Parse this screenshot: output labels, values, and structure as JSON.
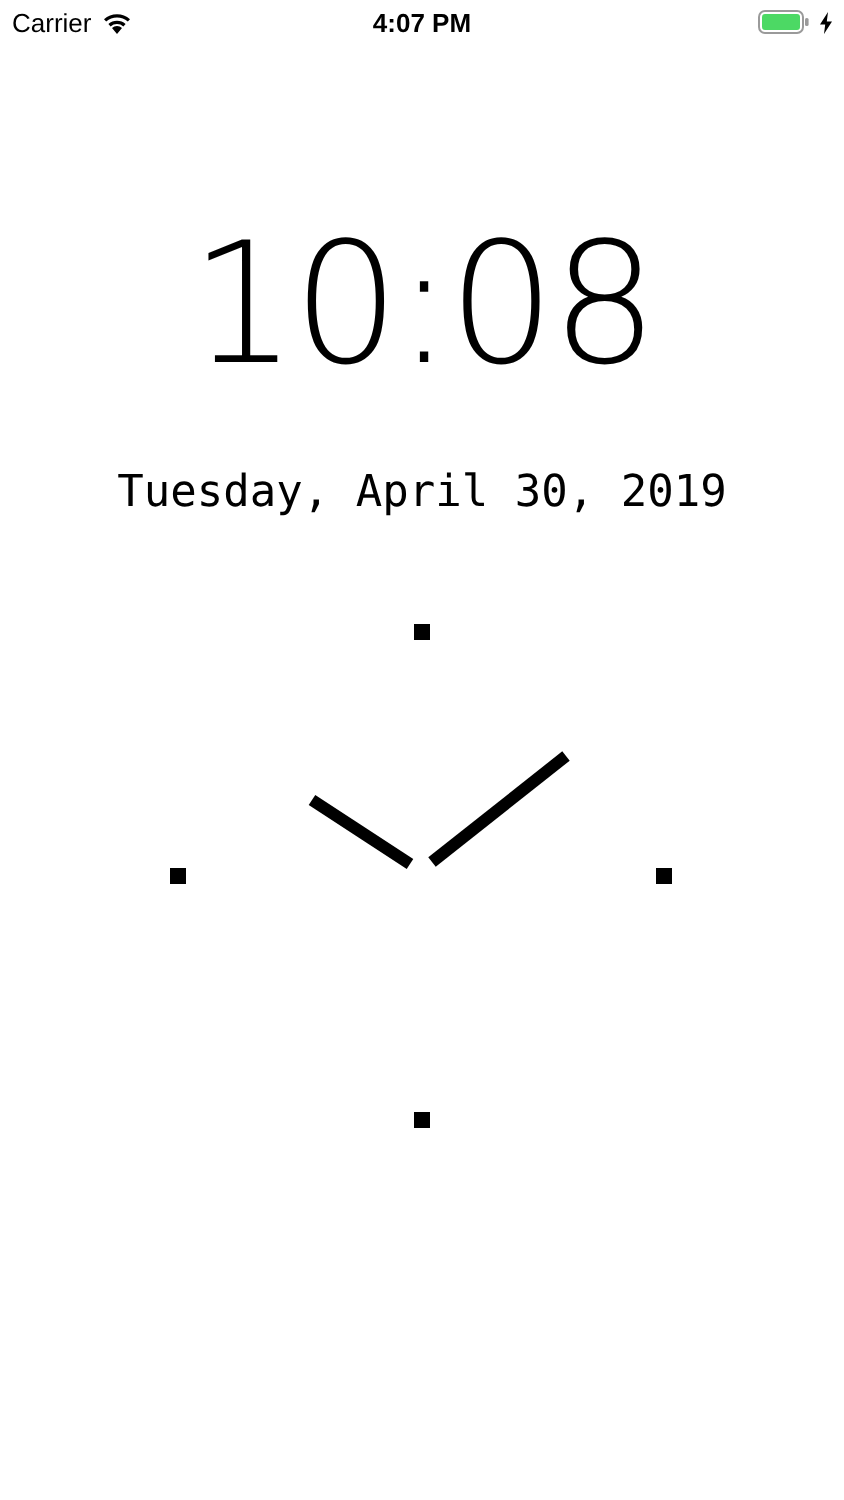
{
  "status_bar": {
    "carrier": "Carrier",
    "time": "4:07 PM"
  },
  "clock": {
    "digital_time": "10:08",
    "date": "Tuesday, April 30, 2019"
  }
}
